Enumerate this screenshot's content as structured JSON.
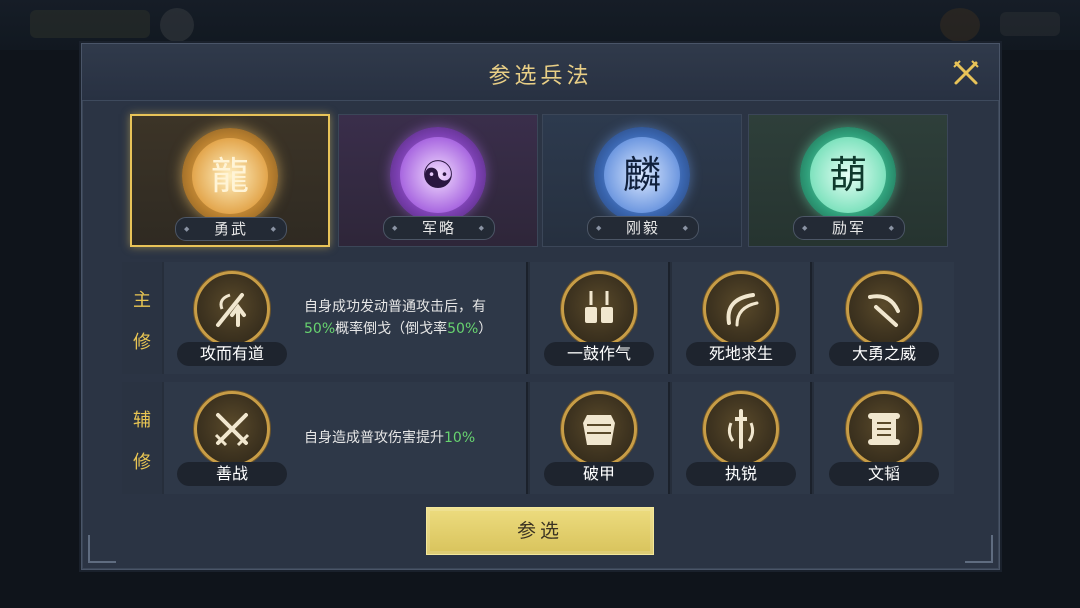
{
  "dialog": {
    "title": "参选兵法"
  },
  "schools": [
    {
      "name": "勇武",
      "selected": true,
      "color": "#e8c358"
    },
    {
      "name": "军略",
      "selected": false,
      "color": "#b66ee6"
    },
    {
      "name": "刚毅",
      "selected": false,
      "color": "#6fa8ff"
    },
    {
      "name": "励军",
      "selected": false,
      "color": "#6ff0c0"
    }
  ],
  "main_row": {
    "label_1": "主",
    "label_2": "修",
    "selected_skill": "攻而有道",
    "desc_part1": "自身成功发动普通攻击后，有",
    "desc_hl1": "50%",
    "desc_part2": "概率倒戈（倒戈率",
    "desc_hl2": "50%",
    "desc_part3": "）",
    "skills": [
      "一鼓作气",
      "死地求生",
      "大勇之威"
    ]
  },
  "aux_row": {
    "label_1": "辅",
    "label_2": "修",
    "selected_skill": "善战",
    "desc_part1": "自身造成普攻伤害提升",
    "desc_hl1": "10%",
    "skills": [
      "破甲",
      "执锐",
      "文韬"
    ]
  },
  "confirm_label": "参选",
  "colors": {
    "accent_gold": "#e8c358",
    "highlight_green": "#67d36f"
  }
}
